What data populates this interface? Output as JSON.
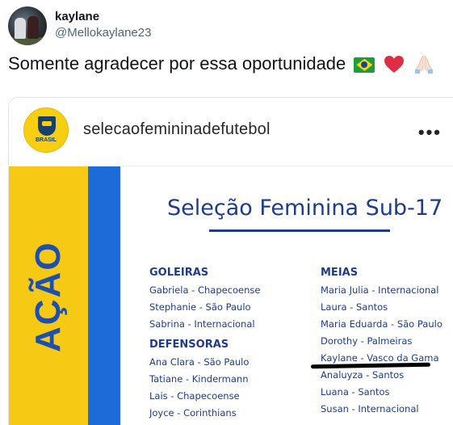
{
  "tweet": {
    "display_name": "kaylane",
    "handle": "@Mellokaylane23",
    "text": "Somente agradecer por essa oportunidade",
    "emojis": [
      "brazil-flag",
      "red-heart",
      "folded-hands"
    ]
  },
  "instagram_post": {
    "account": "selecaofemininadefutebol",
    "logo_text": "BRASIL",
    "more_label": "•••",
    "poster": {
      "side_word": "AÇÃO",
      "title": "Seleção Feminina Sub-17",
      "left_column": [
        {
          "heading": "GOLEIRAS",
          "players": [
            "Gabriela - Chapecoense",
            "Stephanie - São Paulo",
            "Sabrina - Internacional"
          ]
        },
        {
          "heading": "DEFENSORAS",
          "players": [
            "Ana Clara - São Paulo",
            "Tatiane - Kindermann",
            "Lais - Chapecoense",
            "Joyce - Corinthians"
          ]
        }
      ],
      "right_column": [
        {
          "heading": "MEIAS",
          "players": [
            "Maria Julia - Internacional",
            "Laura - Santos",
            "Maria Eduarda - São Paulo",
            "Dorothy - Palmeiras",
            "Kaylane - Vasco da Gama",
            "Analuyza - Santos",
            "Luana - Santos",
            "Susan - Internacional"
          ]
        }
      ]
    }
  },
  "colors": {
    "poster_yellow": "#f6c915",
    "poster_blue": "#1d6bd6",
    "poster_text": "#1f3c88"
  }
}
